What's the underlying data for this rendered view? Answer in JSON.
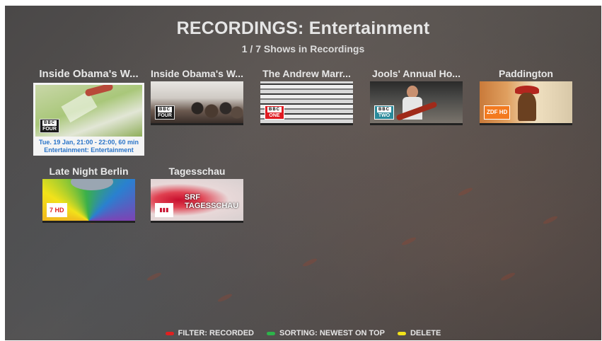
{
  "header": {
    "title": "RECORDINGS: Entertainment",
    "subtitle": "1 / 7 Shows in Recordings"
  },
  "recordings": [
    {
      "title": "Inside Obama's W...",
      "channel": {
        "top": "BBC",
        "bottom": "FOUR"
      },
      "focused": true,
      "info_line1": "Tue. 19 Jan, 21:00 - 22:00, 60 min",
      "info_line2": "Entertainment: Entertainment"
    },
    {
      "title": "Inside Obama's W...",
      "channel": {
        "top": "BBC",
        "bottom": "FOUR"
      }
    },
    {
      "title": "The Andrew Marr...",
      "channel": {
        "top": "BBC",
        "bottom": "ONE"
      }
    },
    {
      "title": "Jools' Annual Ho...",
      "channel": {
        "top": "BBC",
        "bottom": "TWO"
      }
    },
    {
      "title": "Paddington",
      "channel": {
        "top": "",
        "bottom": "ZDF HD"
      }
    },
    {
      "title": "Late Night Berlin",
      "channel": {
        "top": "",
        "bottom": "7 HD"
      }
    },
    {
      "title": "Tagesschau",
      "channel": {
        "top": "SRF",
        "bottom": "TAGESSCHAU"
      }
    }
  ],
  "footer": {
    "red_label": "FILTER: RECORDED",
    "green_label": "SORTING: NEWEST ON TOP",
    "yellow_label": "DELETE"
  },
  "colors": {
    "red": "#e02020",
    "green": "#2db34a",
    "yellow": "#f2e21a",
    "info_text": "#2a74c8"
  }
}
